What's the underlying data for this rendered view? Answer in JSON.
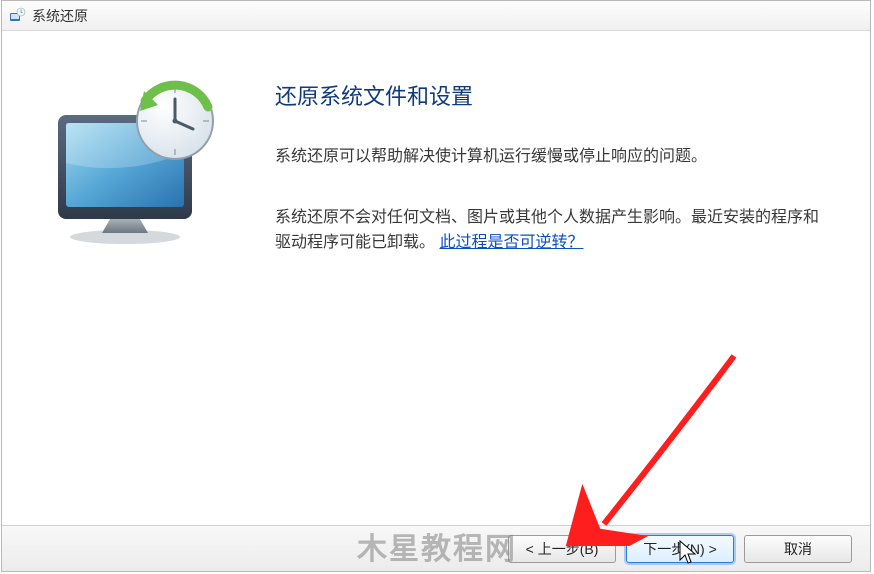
{
  "window": {
    "title": "系统还原"
  },
  "heading": "还原系统文件和设置",
  "paragraph1": "系统还原可以帮助解决使计算机运行缓慢或停止响应的问题。",
  "paragraph2_pre": "系统还原不会对任何文档、图片或其他个人数据产生影响。最近安装的程序和驱动程序可能已卸载。",
  "paragraph2_link": "此过程是否可逆转？",
  "buttons": {
    "back": "< 上一步(B)",
    "next": "下一步(N) >",
    "cancel": "取消"
  },
  "watermark": "木星教程网"
}
